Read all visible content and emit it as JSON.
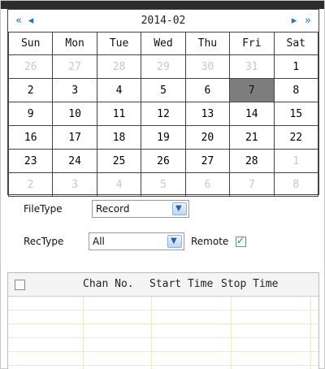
{
  "calendar": {
    "month_title": "2014-02",
    "nav": {
      "prev_year_icon": "«",
      "prev_month_icon": "◂",
      "next_month_icon": "▸",
      "next_year_icon": "»"
    },
    "weekdays": [
      "Sun",
      "Mon",
      "Tue",
      "Wed",
      "Thu",
      "Fri",
      "Sat"
    ],
    "weeks": [
      [
        {
          "d": "26",
          "other": true
        },
        {
          "d": "27",
          "other": true
        },
        {
          "d": "28",
          "other": true
        },
        {
          "d": "29",
          "other": true
        },
        {
          "d": "30",
          "other": true
        },
        {
          "d": "31",
          "other": true
        },
        {
          "d": "1"
        }
      ],
      [
        {
          "d": "2"
        },
        {
          "d": "3"
        },
        {
          "d": "4"
        },
        {
          "d": "5"
        },
        {
          "d": "6"
        },
        {
          "d": "7",
          "selected": true
        },
        {
          "d": "8"
        }
      ],
      [
        {
          "d": "9"
        },
        {
          "d": "10"
        },
        {
          "d": "11"
        },
        {
          "d": "12"
        },
        {
          "d": "13"
        },
        {
          "d": "14"
        },
        {
          "d": "15"
        }
      ],
      [
        {
          "d": "16"
        },
        {
          "d": "17"
        },
        {
          "d": "18"
        },
        {
          "d": "19"
        },
        {
          "d": "20"
        },
        {
          "d": "21"
        },
        {
          "d": "22"
        }
      ],
      [
        {
          "d": "23"
        },
        {
          "d": "24"
        },
        {
          "d": "25"
        },
        {
          "d": "26"
        },
        {
          "d": "27"
        },
        {
          "d": "28"
        },
        {
          "d": "1",
          "other": true
        }
      ],
      [
        {
          "d": "2",
          "other": true
        },
        {
          "d": "3",
          "other": true
        },
        {
          "d": "4",
          "other": true
        },
        {
          "d": "5",
          "other": true
        },
        {
          "d": "6",
          "other": true
        },
        {
          "d": "7",
          "other": true
        },
        {
          "d": "8",
          "other": true
        }
      ]
    ]
  },
  "filters": {
    "filetype_label": "FileType",
    "filetype_value": "Record",
    "rectype_label": "RecType",
    "rectype_value": "All",
    "remote_label": "Remote",
    "remote_checked": true,
    "dropdown_icon": "▼",
    "check_icon": "✓"
  },
  "list": {
    "columns": [
      "Chan No.",
      "Start Time",
      "Stop Time"
    ]
  },
  "colors": {
    "nav_accent": "#1c73c9",
    "selected_day": "#7d7d7d"
  }
}
